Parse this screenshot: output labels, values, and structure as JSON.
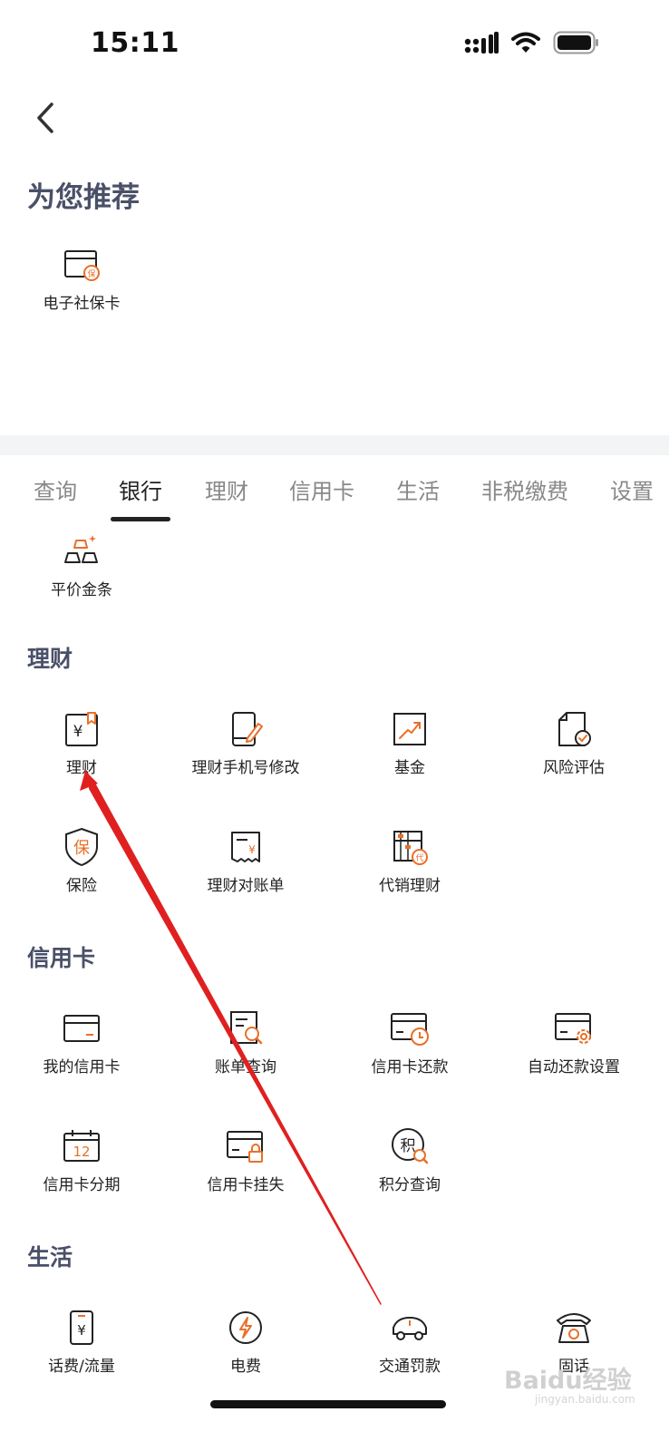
{
  "status_bar": {
    "time": "15:11"
  },
  "recommend": {
    "title": "为您推荐",
    "items": [
      {
        "label": "电子社保卡",
        "icon": "social-security-card-icon"
      }
    ]
  },
  "tabs": [
    {
      "label": "查询",
      "active": false
    },
    {
      "label": "银行",
      "active": true
    },
    {
      "label": "理财",
      "active": false
    },
    {
      "label": "信用卡",
      "active": false
    },
    {
      "label": "生活",
      "active": false
    },
    {
      "label": "非税缴费",
      "active": false
    },
    {
      "label": "设置",
      "active": false
    }
  ],
  "bank_section": {
    "items": [
      {
        "label": "平价金条",
        "icon": "gold-bar-icon"
      }
    ]
  },
  "wealth_section": {
    "title": "理财",
    "items": [
      {
        "label": "理财",
        "icon": "wealth-doc-icon"
      },
      {
        "label": "理财手机号修改",
        "icon": "phone-edit-icon"
      },
      {
        "label": "基金",
        "icon": "fund-chart-icon"
      },
      {
        "label": "风险评估",
        "icon": "risk-assessment-icon"
      },
      {
        "label": "保险",
        "icon": "insurance-shield-icon"
      },
      {
        "label": "理财对账单",
        "icon": "statement-receipt-icon"
      },
      {
        "label": "代销理财",
        "icon": "abacus-icon"
      }
    ]
  },
  "credit_section": {
    "title": "信用卡",
    "items": [
      {
        "label": "我的信用卡",
        "icon": "credit-card-icon"
      },
      {
        "label": "账单查询",
        "icon": "bill-search-icon"
      },
      {
        "label": "信用卡还款",
        "icon": "card-repay-icon"
      },
      {
        "label": "自动还款设置",
        "icon": "card-settings-icon"
      },
      {
        "label": "信用卡分期",
        "icon": "calendar-installment-icon"
      },
      {
        "label": "信用卡挂失",
        "icon": "card-lock-icon"
      },
      {
        "label": "积分查询",
        "icon": "points-search-icon"
      }
    ]
  },
  "life_section": {
    "title": "生活",
    "items": [
      {
        "label": "话费/流量",
        "icon": "phone-bill-icon"
      },
      {
        "label": "电费",
        "icon": "electricity-icon"
      },
      {
        "label": "交通罚款",
        "icon": "car-fine-icon"
      },
      {
        "label": "固话",
        "icon": "landline-phone-icon"
      }
    ]
  },
  "colors": {
    "accent": "#e8702a",
    "title": "#4a5068",
    "annotation": "#e02020"
  },
  "watermark": {
    "text": "Baidu经验",
    "sub": "jingyan.baidu.com"
  }
}
